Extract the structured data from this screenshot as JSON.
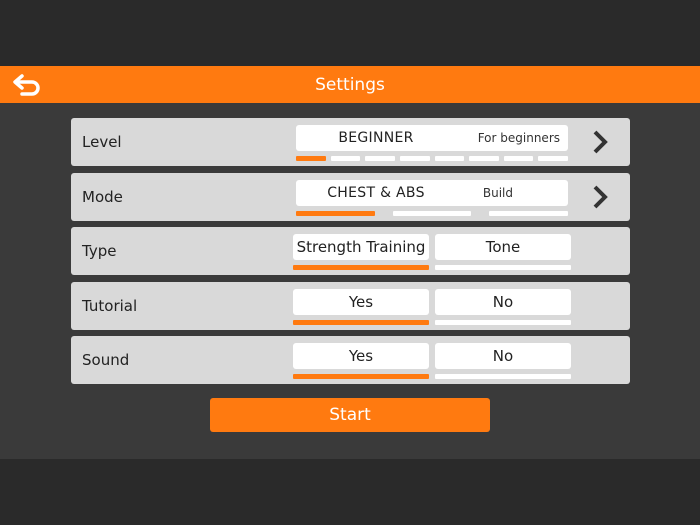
{
  "header": {
    "title": "Settings",
    "back_icon": "back-arrow-icon"
  },
  "colors": {
    "accent": "#ff7a10",
    "row_bg": "#d9d9d9",
    "panel_bg": "#3a3a3a"
  },
  "level": {
    "label": "Level",
    "value": "BEGINNER",
    "description": "For beginners",
    "steps_total": 8,
    "steps_active": 1
  },
  "mode": {
    "label": "Mode",
    "value": "CHEST & ABS",
    "description": "Build",
    "steps_total": 3,
    "steps_active": 1
  },
  "type": {
    "label": "Type",
    "options": [
      "Strength Training",
      "Tone"
    ],
    "selected": 0
  },
  "tutorial": {
    "label": "Tutorial",
    "options": [
      "Yes",
      "No"
    ],
    "selected": 0
  },
  "sound": {
    "label": "Sound",
    "options": [
      "Yes",
      "No"
    ],
    "selected": 0
  },
  "start": {
    "label": "Start"
  }
}
